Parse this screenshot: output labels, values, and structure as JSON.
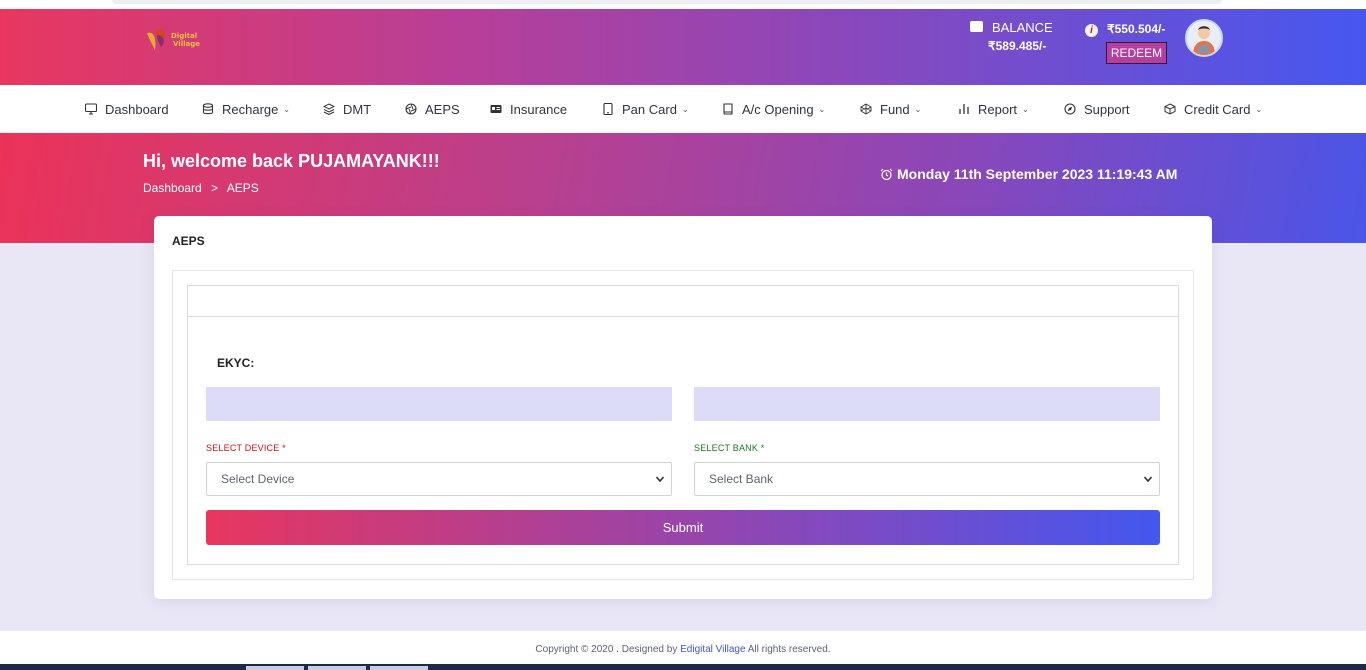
{
  "header": {
    "logo_line1": "Digital",
    "logo_line2": "Village",
    "balance_label": "BALANCE",
    "balance_value": "₹589.485/-",
    "points_value": "₹550.504/-",
    "redeem_label": "REDEEM"
  },
  "nav": {
    "items": [
      {
        "label": "Dashboard",
        "icon": "monitor-icon"
      },
      {
        "label": "Recharge",
        "icon": "database-icon"
      },
      {
        "label": "DMT",
        "icon": "layers-icon"
      },
      {
        "label": "AEPS",
        "icon": "aperture-icon"
      },
      {
        "label": "Insurance",
        "icon": "id-card-icon"
      },
      {
        "label": "Pan Card",
        "icon": "tablet-icon"
      },
      {
        "label": "A/c Opening",
        "icon": "book-icon"
      },
      {
        "label": "Fund",
        "icon": "codepen-icon"
      },
      {
        "label": "Report",
        "icon": "bar-chart-icon"
      },
      {
        "label": "Support",
        "icon": "compass-icon"
      },
      {
        "label": "Credit Card",
        "icon": "box-icon"
      }
    ]
  },
  "hero": {
    "welcome": "Hi, welcome back PUJAMAYANK!!!",
    "breadcrumb_home": "Dashboard",
    "breadcrumb_sep": ">",
    "breadcrumb_current": "AEPS",
    "datetime": "Monday 11th September 2023 11:19:43 AM"
  },
  "card": {
    "title": "AEPS",
    "ekyc_label": "EKYC:",
    "device_label": "SELECT DEVICE *",
    "device_placeholder": "Select Device",
    "bank_label": "SELECT BANK *",
    "bank_placeholder": "Select Bank",
    "submit_label": "Submit"
  },
  "colors": {
    "device_label": "#c0141c",
    "bank_label": "#1d7a1d"
  },
  "footer": {
    "text_before": "Copyright © 2020 . Designed by",
    "link_text": "Edigital Village",
    "text_after": "All rights reserved."
  }
}
